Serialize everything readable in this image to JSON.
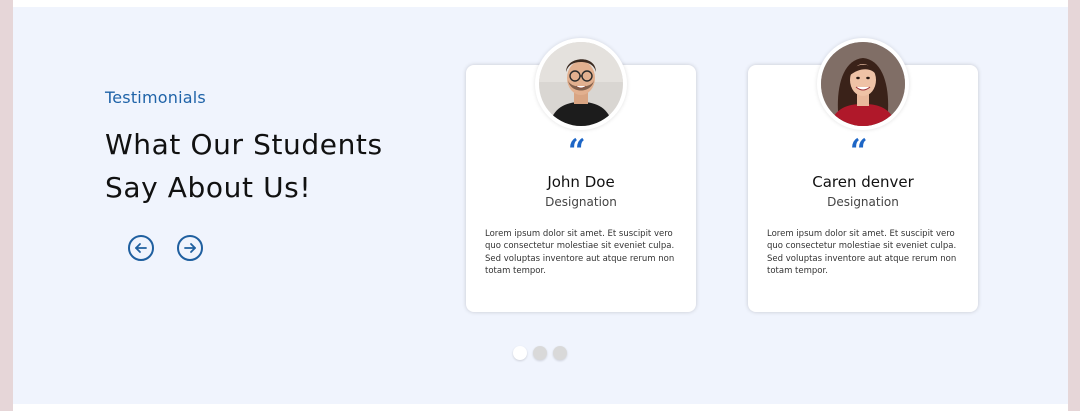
{
  "section": {
    "eyebrow": "Testimonials",
    "heading_line1": "What Our Students",
    "heading_line2": "Say About Us!"
  },
  "nav": {
    "prev_icon": "arrow-left-circle-icon",
    "next_icon": "arrow-right-circle-icon",
    "accent": "#1f5f9f"
  },
  "testimonials": [
    {
      "name": "John Doe",
      "designation": "Designation",
      "quote_mark": "“",
      "text": "Lorem ipsum dolor sit amet. Et suscipit vero quo consectetur molestiae sit eveniet culpa. Sed voluptas inventore aut atque rerum non totam tempor.",
      "avatar_icon": "man-avatar-photo"
    },
    {
      "name": "Caren denver",
      "designation": "Designation",
      "quote_mark": "“",
      "text": "Lorem ipsum dolor sit amet. Et suscipit vero quo consectetur molestiae sit eveniet culpa. Sed voluptas inventore aut atque rerum non totam tempor.",
      "avatar_icon": "woman-avatar-photo"
    }
  ],
  "pagination": {
    "count": 3,
    "active_index": 0
  },
  "colors": {
    "background": "#f0f4fd",
    "accent_blue": "#1f63a8",
    "quote_blue": "#1d66c6"
  }
}
